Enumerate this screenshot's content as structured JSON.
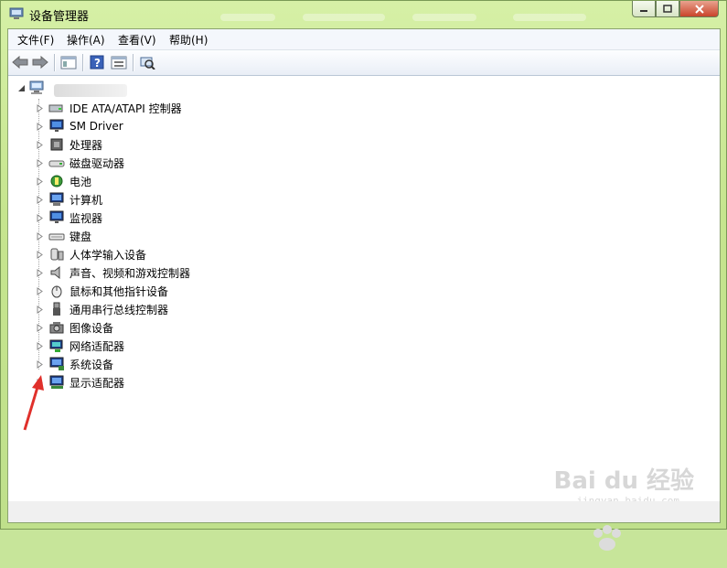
{
  "window": {
    "title": "设备管理器"
  },
  "controls": {
    "minimize": "—",
    "maximize": "□",
    "close": "✕"
  },
  "menu": [
    "文件(F)",
    "操作(A)",
    "查看(V)",
    "帮助(H)"
  ],
  "tree": {
    "root_label": "",
    "items": [
      {
        "label": "IDE ATA/ATAPI 控制器",
        "icon": "ide-controller-icon"
      },
      {
        "label": "SM Driver",
        "icon": "monitor-icon"
      },
      {
        "label": "处理器",
        "icon": "processor-icon"
      },
      {
        "label": "磁盘驱动器",
        "icon": "disk-drive-icon"
      },
      {
        "label": "电池",
        "icon": "battery-icon"
      },
      {
        "label": "计算机",
        "icon": "computer-icon"
      },
      {
        "label": "监视器",
        "icon": "monitor-icon"
      },
      {
        "label": "键盘",
        "icon": "keyboard-icon"
      },
      {
        "label": "人体学输入设备",
        "icon": "hid-icon"
      },
      {
        "label": "声音、视频和游戏控制器",
        "icon": "speaker-icon"
      },
      {
        "label": "鼠标和其他指针设备",
        "icon": "mouse-icon"
      },
      {
        "label": "通用串行总线控制器",
        "icon": "usb-icon"
      },
      {
        "label": "图像设备",
        "icon": "camera-icon"
      },
      {
        "label": "网络适配器",
        "icon": "network-adapter-icon"
      },
      {
        "label": "系统设备",
        "icon": "system-device-icon"
      },
      {
        "label": "显示适配器",
        "icon": "display-adapter-icon"
      }
    ]
  },
  "watermark": {
    "text": "Bai du 经验",
    "url": "jingyan.baidu.com"
  },
  "colors": {
    "arrow": "#e0302b",
    "frame": "#c7e59a"
  }
}
